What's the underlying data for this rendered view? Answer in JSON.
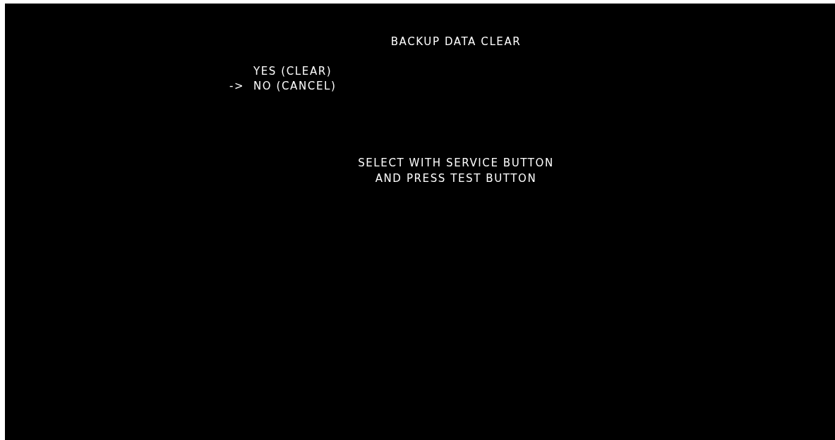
{
  "title": "BACKUP DATA CLEAR",
  "cursor": "->",
  "options": [
    {
      "label": "YES (CLEAR)",
      "selected": false
    },
    {
      "label": "NO (CANCEL)",
      "selected": true
    }
  ],
  "instructions": [
    "SELECT WITH SERVICE BUTTON",
    "AND PRESS TEST BUTTON"
  ]
}
